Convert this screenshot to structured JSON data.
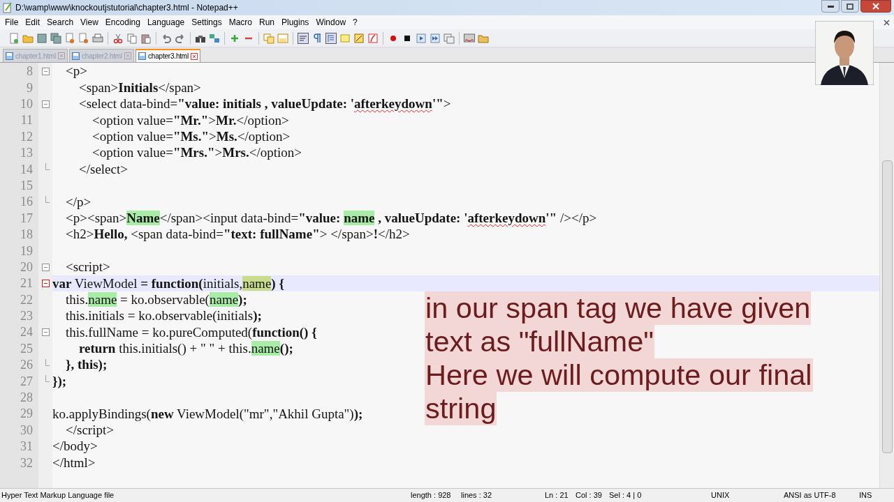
{
  "window": {
    "title": "D:\\wamp\\www\\knockoutjstutorial\\chapter3.html - Notepad++"
  },
  "menu": [
    "File",
    "Edit",
    "Search",
    "View",
    "Encoding",
    "Language",
    "Settings",
    "Macro",
    "Run",
    "Plugins",
    "Window",
    "?"
  ],
  "tabs": [
    {
      "label": "chapter1.html",
      "selected": false
    },
    {
      "label": "chapter2.html",
      "selected": false
    },
    {
      "label": "chapter3.html",
      "selected": true
    }
  ],
  "editor": {
    "lines": [
      {
        "number": "8",
        "fold_start": true,
        "fold_end": false,
        "current": false,
        "segments": [
          {
            "text": "    <p>"
          }
        ]
      },
      {
        "number": "9",
        "fold_start": false,
        "fold_end": false,
        "current": false,
        "segments": [
          {
            "text": "        <span>"
          },
          {
            "text": "Initials",
            "bold": true
          },
          {
            "text": "</span>"
          }
        ]
      },
      {
        "number": "10",
        "fold_start": true,
        "fold_end": false,
        "current": false,
        "segments": [
          {
            "text": "        <select data-bind="
          },
          {
            "text": "\"value: initials , valueUpdate: '",
            "bold": true
          },
          {
            "text": "afterkeydown",
            "bold": true,
            "misspelled": true
          },
          {
            "text": "'\"",
            "bold": true
          },
          {
            "text": ">"
          }
        ]
      },
      {
        "number": "11",
        "fold_start": false,
        "fold_end": false,
        "current": false,
        "segments": [
          {
            "text": "            <option value="
          },
          {
            "text": "\"Mr.\"",
            "bold": true
          },
          {
            "text": ">"
          },
          {
            "text": "Mr.",
            "bold": true
          },
          {
            "text": "</option>"
          }
        ]
      },
      {
        "number": "12",
        "fold_start": false,
        "fold_end": false,
        "current": false,
        "segments": [
          {
            "text": "            <option value="
          },
          {
            "text": "\"Ms.\"",
            "bold": true
          },
          {
            "text": ">"
          },
          {
            "text": "Ms.",
            "bold": true
          },
          {
            "text": "</option>"
          }
        ]
      },
      {
        "number": "13",
        "fold_start": false,
        "fold_end": false,
        "current": false,
        "segments": [
          {
            "text": "            <option value="
          },
          {
            "text": "\"Mrs.\"",
            "bold": true
          },
          {
            "text": ">"
          },
          {
            "text": "Mrs.",
            "bold": true
          },
          {
            "text": "</option>"
          }
        ]
      },
      {
        "number": "14",
        "fold_start": false,
        "fold_end": true,
        "current": false,
        "segments": [
          {
            "text": "        </select>"
          }
        ]
      },
      {
        "number": "15",
        "fold_start": false,
        "fold_end": false,
        "current": false
      },
      {
        "number": "16",
        "fold_start": false,
        "fold_end": true,
        "current": false,
        "segments": [
          {
            "text": "    </p>"
          }
        ]
      },
      {
        "number": "17",
        "fold_start": false,
        "fold_end": false,
        "current": false,
        "segments": [
          {
            "text": "    <p><span>"
          },
          {
            "text": "Name",
            "bold": true,
            "highlighted": true
          },
          {
            "text": "</span><input data-bind="
          },
          {
            "text": "\"value: ",
            "bold": true
          },
          {
            "text": "name",
            "bold": true,
            "highlighted": true
          },
          {
            "text": " , valueUpdate: '",
            "bold": true
          },
          {
            "text": "afterkeydown",
            "bold": true,
            "misspelled": true
          },
          {
            "text": "'\"",
            "bold": true
          },
          {
            "text": " /></p>"
          }
        ]
      },
      {
        "number": "18",
        "fold_start": false,
        "fold_end": false,
        "current": false,
        "segments": [
          {
            "text": "    <h2>"
          },
          {
            "text": "Hello,",
            "bold": true
          },
          {
            "text": " <span data-bind="
          },
          {
            "text": "\"text: fullName\"",
            "bold": true
          },
          {
            "text": "> </span>"
          },
          {
            "text": "!",
            "bold": true
          },
          {
            "text": "</h2>"
          }
        ]
      },
      {
        "number": "19",
        "fold_start": false,
        "fold_end": false,
        "current": false
      },
      {
        "number": "20",
        "fold_start": true,
        "fold_end": false,
        "current": false,
        "segments": [
          {
            "text": "    <script>"
          }
        ]
      },
      {
        "number": "21",
        "fold_start": true,
        "fold_end": false,
        "current": true,
        "segments": [
          {
            "text": "var",
            "bold": true
          },
          {
            "text": " ViewModel "
          },
          {
            "text": "= function(",
            "bold": true
          },
          {
            "text": "initials,"
          },
          {
            "text": "name",
            "selected": true
          },
          {
            "text": ") {",
            "bold": true
          }
        ]
      },
      {
        "number": "22",
        "fold_start": false,
        "fold_end": false,
        "current": false,
        "segments": [
          {
            "text": "    this."
          },
          {
            "text": "name",
            "highlighted": true
          },
          {
            "text": " = ko.observable("
          },
          {
            "text": "name",
            "highlighted": true
          },
          {
            "text": ");",
            "bold": true
          }
        ]
      },
      {
        "number": "23",
        "fold_start": false,
        "fold_end": false,
        "current": false,
        "segments": [
          {
            "text": "    this.initials = ko.observable(initials"
          },
          {
            "text": ");",
            "bold": true
          }
        ]
      },
      {
        "number": "24",
        "fold_start": true,
        "fold_end": false,
        "current": false,
        "segments": [
          {
            "text": "    this.fullName = ko.pureComputed("
          },
          {
            "text": "function() {",
            "bold": true
          }
        ]
      },
      {
        "number": "25",
        "fold_start": false,
        "fold_end": false,
        "current": false,
        "segments": [
          {
            "text": "        return",
            "bold": true
          },
          {
            "text": " this.initials() + \" \" + this."
          },
          {
            "text": "name",
            "highlighted": true
          },
          {
            "text": "();",
            "bold": true
          }
        ]
      },
      {
        "number": "26",
        "fold_start": false,
        "fold_end": true,
        "current": false,
        "segments": [
          {
            "text": "    }, this);",
            "bold": true
          }
        ]
      },
      {
        "number": "27",
        "fold_start": false,
        "fold_end": true,
        "current": false,
        "segments": [
          {
            "text": "});",
            "bold": true
          }
        ]
      },
      {
        "number": "28",
        "fold_start": false,
        "fold_end": false,
        "current": false
      },
      {
        "number": "29",
        "fold_start": false,
        "fold_end": false,
        "current": false,
        "segments": [
          {
            "text": "ko.applyBindings("
          },
          {
            "text": "new",
            "bold": true
          },
          {
            "text": " ViewModel(\"mr\",\"Akhil Gupta\")"
          },
          {
            "text": ");",
            "bold": true
          }
        ]
      },
      {
        "number": "30",
        "fold_start": false,
        "fold_end": false,
        "current": false,
        "segments": [
          {
            "text": "    </script>"
          }
        ]
      },
      {
        "number": "31",
        "fold_start": false,
        "fold_end": false,
        "current": false,
        "segments": [
          {
            "text": "</body>"
          }
        ]
      },
      {
        "number": "32",
        "fold_start": false,
        "fold_end": false,
        "current": false,
        "segments": [
          {
            "text": "</html>"
          }
        ]
      }
    ]
  },
  "caption": [
    "in our span tag we have given",
    "text as \"fullName\"",
    "Here we will compute our final",
    "string"
  ],
  "webcam": {
    "kind": "picture"
  },
  "status_bar": {
    "file_type": "Hyper Text Markup Language file",
    "length": "length : 928",
    "lines": "lines : 32",
    "line": "Ln : 21",
    "column": "Col : 39",
    "selection": "Sel : 4 | 0",
    "eol": "UNIX",
    "encoding": "ANSI as UTF-8",
    "mode": "INS"
  }
}
